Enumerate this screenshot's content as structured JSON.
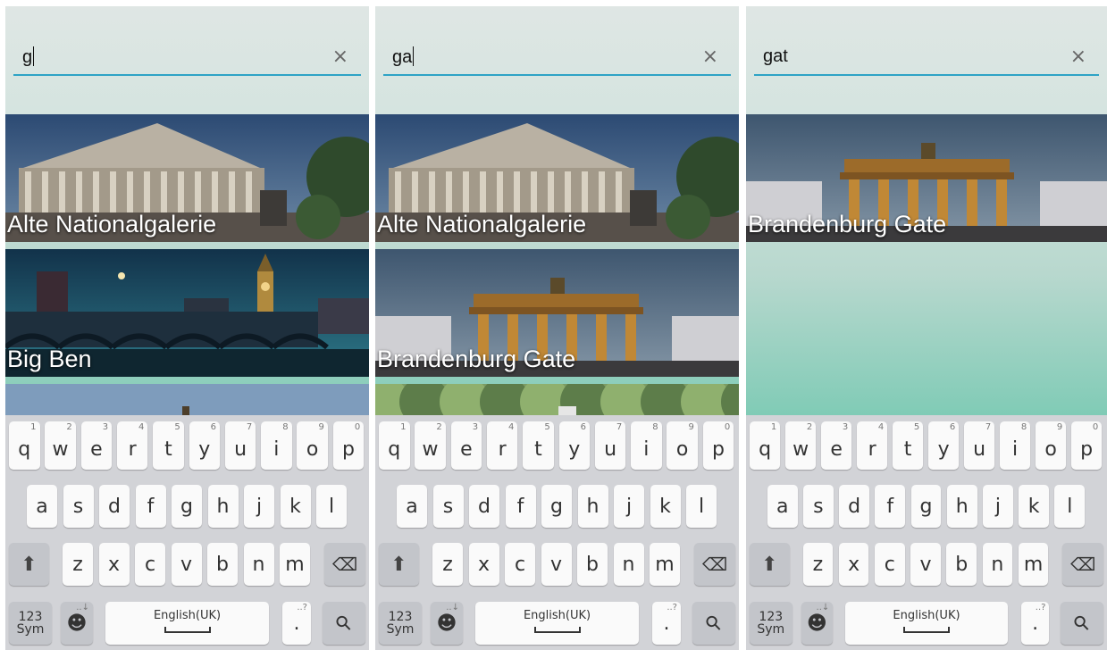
{
  "panels": [
    {
      "query": "g",
      "cursor": true,
      "results": [
        {
          "label": "Alte Nationalgalerie",
          "scene": "museum"
        },
        {
          "label": "Big Ben",
          "scene": "bigben"
        },
        {
          "label": "",
          "scene": "partial-sky"
        }
      ]
    },
    {
      "query": "ga",
      "cursor": true,
      "results": [
        {
          "label": "Alte Nationalgalerie",
          "scene": "museum"
        },
        {
          "label": "Brandenburg Gate",
          "scene": "gate"
        },
        {
          "label": "",
          "scene": "partial-trees"
        }
      ]
    },
    {
      "query": "gat",
      "cursor": false,
      "results": [
        {
          "label": "Brandenburg Gate",
          "scene": "gate"
        }
      ]
    }
  ],
  "clear_icon": "×",
  "keyboard": {
    "row1": [
      {
        "char": "q",
        "hint": "1"
      },
      {
        "char": "w",
        "hint": "2"
      },
      {
        "char": "e",
        "hint": "3"
      },
      {
        "char": "r",
        "hint": "4"
      },
      {
        "char": "t",
        "hint": "5"
      },
      {
        "char": "y",
        "hint": "6"
      },
      {
        "char": "u",
        "hint": "7"
      },
      {
        "char": "i",
        "hint": "8"
      },
      {
        "char": "o",
        "hint": "9"
      },
      {
        "char": "p",
        "hint": "0"
      }
    ],
    "row2": [
      "a",
      "s",
      "d",
      "f",
      "g",
      "h",
      "j",
      "k",
      "l"
    ],
    "row3": [
      "z",
      "x",
      "c",
      "v",
      "b",
      "n",
      "m"
    ],
    "shift_icon": "⬆",
    "backspace_icon": "⌫",
    "sym_label_top": "123",
    "sym_label_bottom": "Sym",
    "emoji_icon": "☻",
    "emoji_hint": "..↓",
    "space_label": "English(UK)",
    "period": ".",
    "period_hint": "..?",
    "search_icon": "⚲",
    "colors": {
      "background": "#d2d3d7",
      "key": "#fafafa",
      "dark_key": "#c3c5ca"
    }
  },
  "colors": {
    "accent": "#2ea3c5",
    "label": "#ffffff"
  }
}
